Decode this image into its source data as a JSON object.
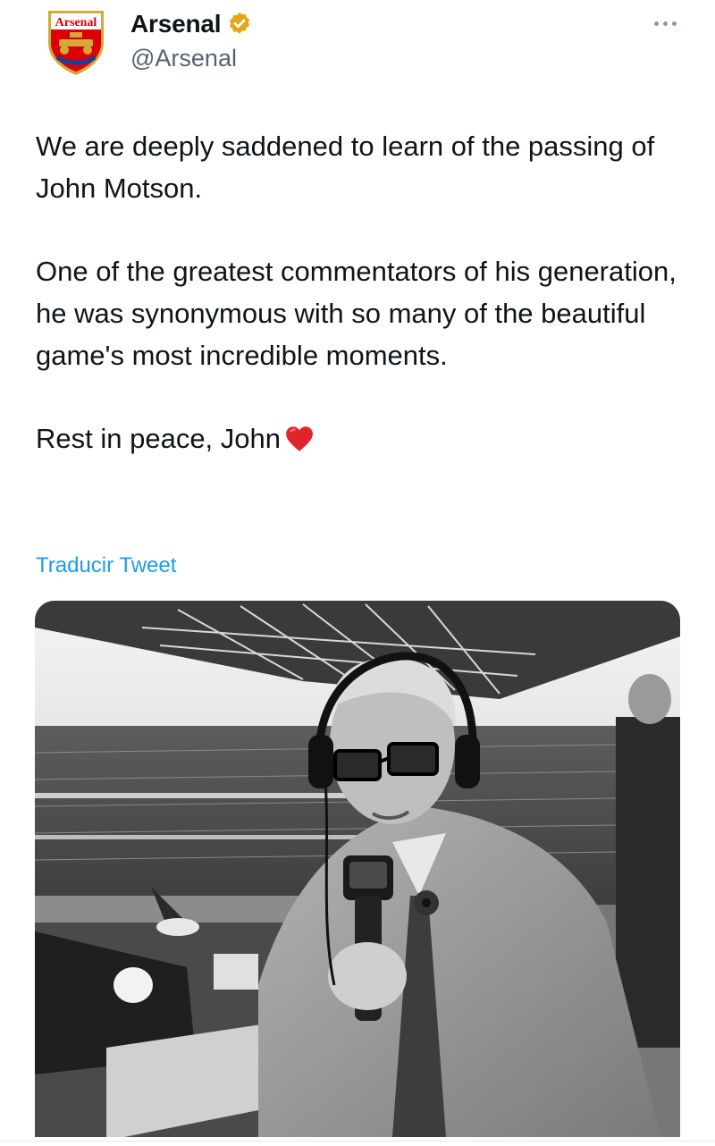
{
  "account": {
    "display_name": "Arsenal",
    "handle": "@Arsenal",
    "avatar_text": "Arsenal",
    "verified": true,
    "verified_color": "#e8a317"
  },
  "tweet": {
    "paragraphs": [
      "We are deeply saddened to learn of the passing of John Motson.",
      "One of the greatest commentators of his generation, he was synonymous with so many of the beautiful game's most incredible moments.",
      "Rest in peace, John"
    ],
    "emoji": "red-heart"
  },
  "actions": {
    "translate_label": "Traducir Tweet",
    "more_icon": "more-horizontal-icon"
  },
  "colors": {
    "link": "#1d9bf0",
    "secondary_text": "#536471",
    "arsenal_red": "#db0007"
  }
}
